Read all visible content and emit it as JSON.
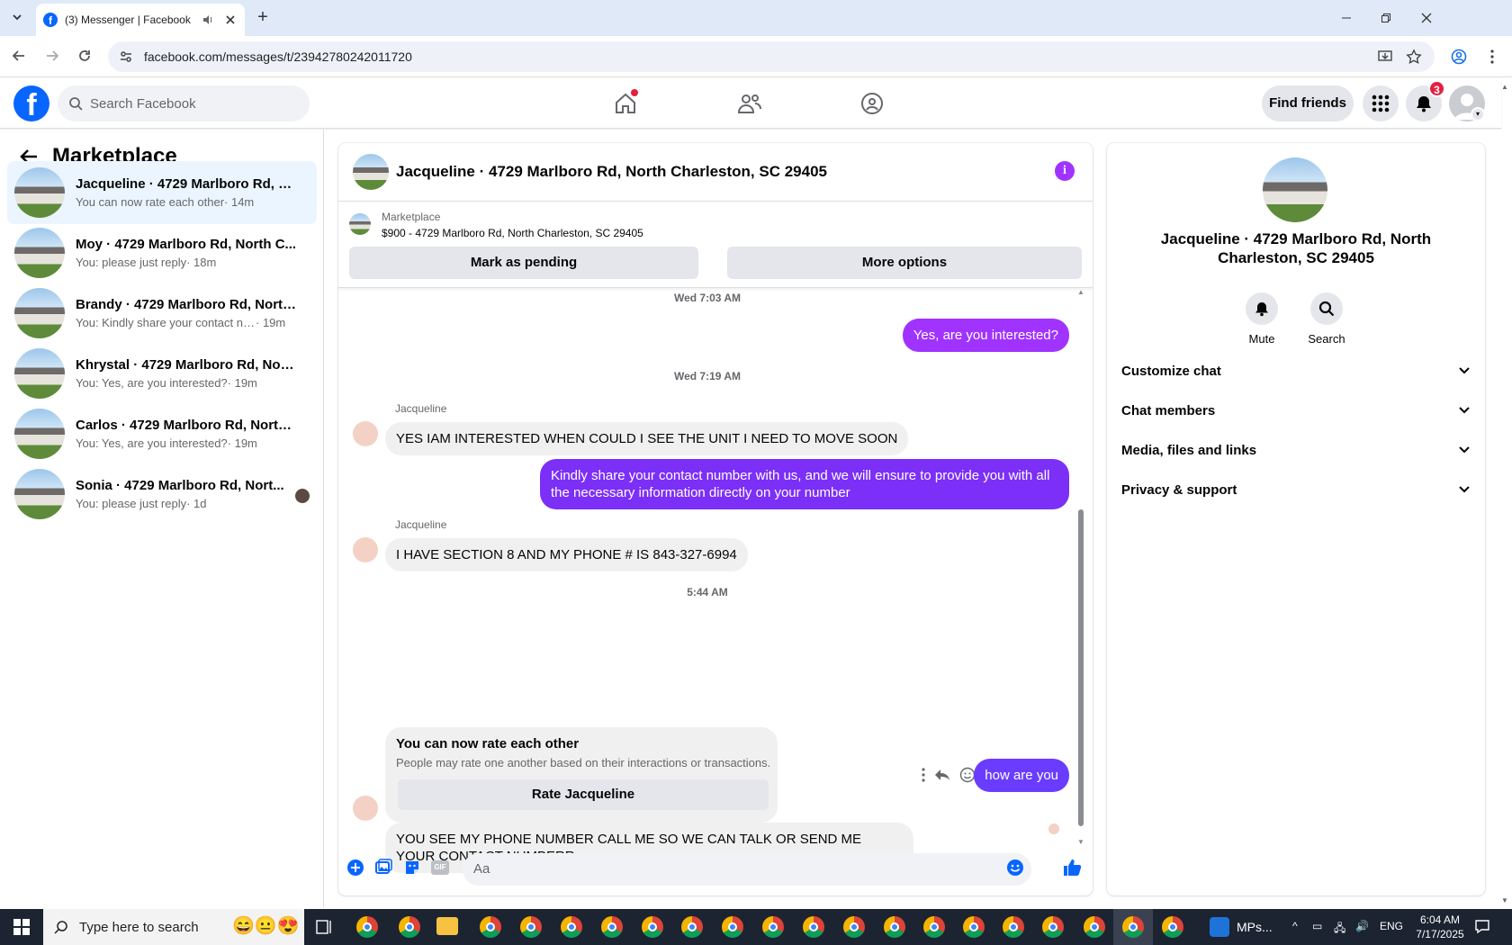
{
  "browser": {
    "tab_title": "(3) Messenger | Facebook",
    "url": "facebook.com/messages/t/23942780242011720"
  },
  "fb_header": {
    "search_placeholder": "Search Facebook",
    "find_friends": "Find friends",
    "notification_count": "3"
  },
  "left": {
    "title": "Marketplace",
    "chats": [
      {
        "name": "Jacqueline · 4729 Marlboro Rd, No...",
        "snippet": "You can now rate each other",
        "time": "· 14m",
        "active": true
      },
      {
        "name": "Moy · 4729 Marlboro Rd, North C...",
        "snippet": "You: please just reply",
        "time": "· 18m"
      },
      {
        "name": "Brandy · 4729 Marlboro Rd, North ...",
        "snippet": "You: Kindly share your contact num...",
        "time": "· 19m"
      },
      {
        "name": "Khrystal · 4729 Marlboro Rd, Nort...",
        "snippet": "You: Yes, are you interested?",
        "time": "· 19m"
      },
      {
        "name": "Carlos · 4729 Marlboro Rd, North ...",
        "snippet": "You: Yes, are you interested?",
        "time": "· 19m"
      },
      {
        "name": "Sonia · 4729 Marlboro Rd, Nort...",
        "snippet": "You: please just reply",
        "time": "· 1d"
      }
    ]
  },
  "chat": {
    "title": "Jacqueline · 4729 Marlboro Rd, North Charleston, SC 29405",
    "marketplace_label": "Marketplace",
    "listing": "$900 - 4729 Marlboro Rd, North Charleston, SC 29405",
    "mark_pending": "Mark as pending",
    "more_options": "More options",
    "ts1": "Wed 7:03 AM",
    "msg_out1": "Yes, are you interested?",
    "ts2": "Wed 7:19 AM",
    "sender": "Jacqueline",
    "msg_in1": "YES IAM INTERESTED WHEN COULD I SEE THE UNIT I NEED TO MOVE SOON",
    "msg_out2": "Kindly share your contact number with us, and we will ensure to provide you with all the necessary information directly on your number",
    "msg_in2": "I HAVE SECTION 8 AND MY PHONE # IS 843-327-6994",
    "ts3": "5:44 AM",
    "msg_out3": "how are you",
    "msg_in3": "YOU SEE MY PHONE NUMBER CALL ME SO WE CAN TALK OR SEND ME YOUR CONTACT NUMBERR",
    "rate_title": "You can now rate each other",
    "rate_sub": "People may rate one another based on their interactions or transactions.",
    "rate_button": "Rate Jacqueline",
    "composer_placeholder": "Aa"
  },
  "right": {
    "name": "Jacqueline · 4729 Marlboro Rd, North Charleston, SC 29405",
    "mute": "Mute",
    "search": "Search",
    "sections": [
      "Customize chat",
      "Chat members",
      "Media, files and links",
      "Privacy & support"
    ]
  },
  "taskbar": {
    "search_placeholder": "Type here to search",
    "app_label": "MPs...",
    "lang": "ENG",
    "time": "6:04 AM",
    "date": "7/17/2025"
  },
  "colors": {
    "fb_blue": "#0866ff",
    "bubble_purple": "#a033ff",
    "bubble_violet": "#7b2ff7",
    "bubble_indigo": "#6a3cff"
  }
}
